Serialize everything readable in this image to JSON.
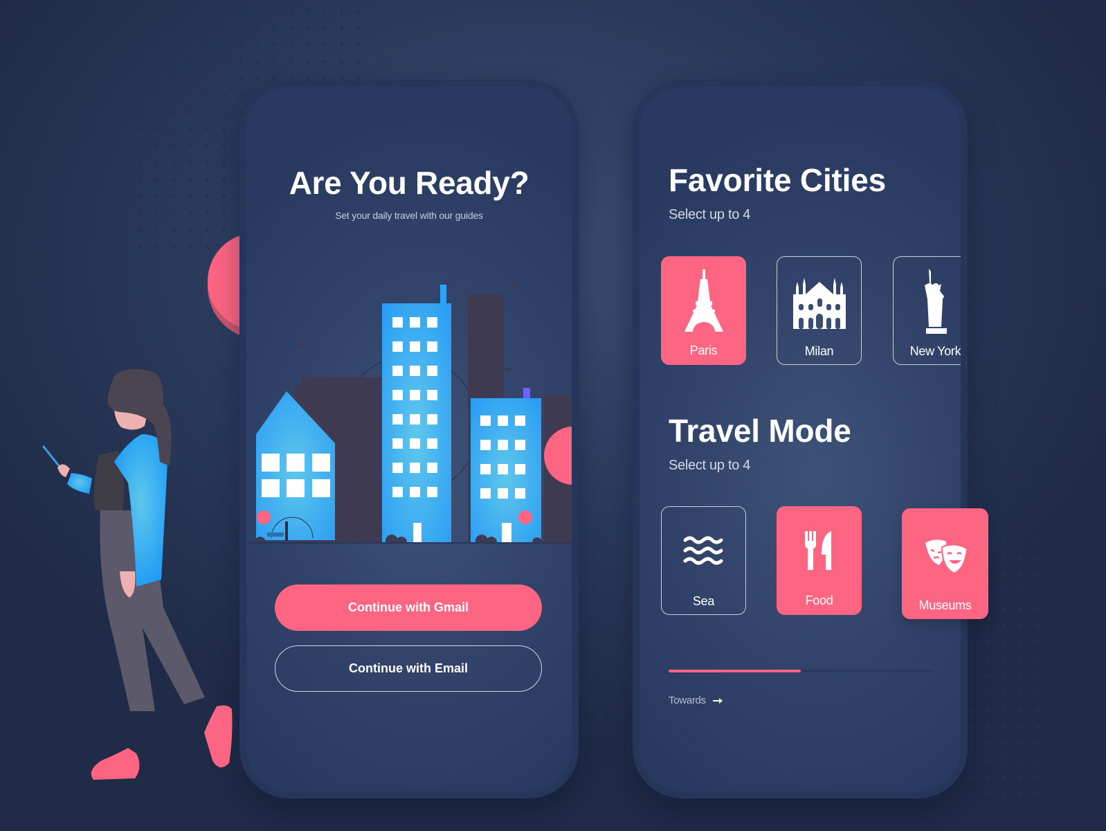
{
  "colors": {
    "accent": "#fd6583",
    "background": "#2c3d5f",
    "phone_bezel": "#26355a",
    "building_blue": "#2ea3f2"
  },
  "onboarding": {
    "title": "Are You Ready?",
    "subtitle": "Set your daily travel with our guides",
    "illustration": "city-skyline-illustration",
    "buttons": {
      "gmail_label": "Continue with Gmail",
      "email_label": "Continue with Email"
    }
  },
  "preferences": {
    "favorite_cities": {
      "title": "Favorite Cities",
      "hint": "Select up to 4",
      "items": [
        {
          "label": "Paris",
          "icon": "eiffel-tower-icon",
          "selected": true
        },
        {
          "label": "Milan",
          "icon": "milan-cathedral-icon",
          "selected": false
        },
        {
          "label": "New York",
          "icon": "statue-of-liberty-icon",
          "selected": false
        }
      ]
    },
    "travel_mode": {
      "title": "Travel Mode",
      "hint": "Select up to 4",
      "items": [
        {
          "label": "Sea",
          "icon": "waves-icon",
          "selected": false
        },
        {
          "label": "Food",
          "icon": "fork-knife-icon",
          "selected": true
        },
        {
          "label": "Museums",
          "icon": "theater-masks-icon",
          "selected": true
        }
      ]
    },
    "progress": {
      "value_percent": 50
    },
    "next_link": {
      "label": "Towards",
      "icon": "arrow-right-icon"
    }
  },
  "decor": {
    "person": "woman-with-phone-illustration",
    "tree": "pink-tree-illustration"
  }
}
